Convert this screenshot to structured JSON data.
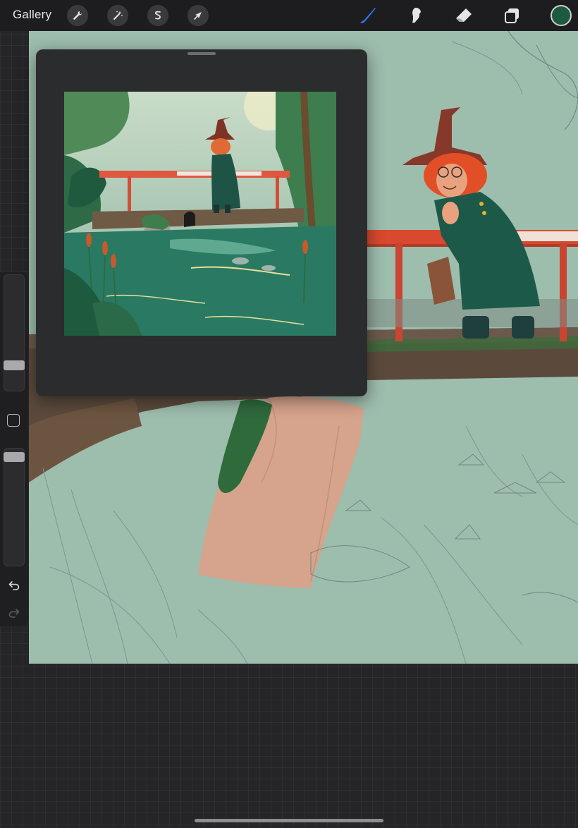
{
  "toolbar": {
    "gallery_label": "Gallery",
    "left_tools": [
      "wrench-icon",
      "magic-wand-icon",
      "selection-icon",
      "transform-arrow-icon"
    ],
    "right_tools": [
      "brush-icon",
      "smudge-icon",
      "eraser-icon",
      "layers-icon"
    ],
    "active_tool": "brush-icon",
    "active_color": "#1d5a40",
    "accent_color": "#2f7cf6"
  },
  "sidebar": {
    "brush_size_level": 0.2,
    "opacity_level": 0.96,
    "controls": [
      "brush-size-slider",
      "modifier-button",
      "opacity-slider",
      "undo-icon",
      "redo-icon"
    ]
  },
  "reference": {
    "title": "",
    "colors": {
      "water": "#2a7a63",
      "railing": "#e0573f",
      "witch_coat": "#1e5446",
      "sky": "#aac7b4"
    }
  },
  "canvas": {
    "background": "#9dbdad",
    "colors": {
      "railing": "#d8492f",
      "hair": "#e24e25",
      "hat": "#86382b",
      "coat": "#1c5949",
      "bridge": "#5b4a3c",
      "pillar": "#d6a38c",
      "moss": "#2f6a3b"
    }
  }
}
